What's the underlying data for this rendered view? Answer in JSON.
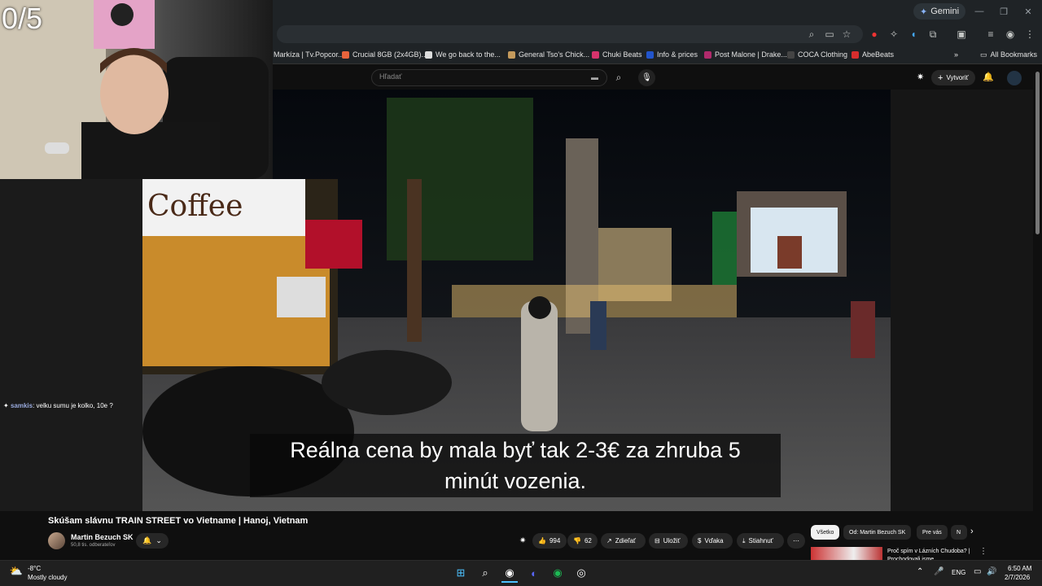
{
  "browser": {
    "gemini_label": "Gemini",
    "bookmarks": [
      {
        "label": "Markíza | Tv.Popcor...",
        "color": "#6b7a8f"
      },
      {
        "label": "Crucial 8GB (2x4GB)...",
        "color": "#e8643c"
      },
      {
        "label": "We go back to the...",
        "color": "#dddddd"
      },
      {
        "label": "General Tso's Chick...",
        "color": "#c49a5c"
      },
      {
        "label": "Chuki Beats",
        "color": "#d6336c"
      },
      {
        "label": "Info & prices",
        "color": "#2255cc"
      },
      {
        "label": "Post Malone | Drake...",
        "color": "#b02a6b"
      },
      {
        "label": "COCA Clothing",
        "color": "#222222"
      },
      {
        "label": "AbeBeats",
        "color": "#d62d2d"
      }
    ],
    "all_bookmarks": "All Bookmarks"
  },
  "youtube": {
    "search_placeholder": "Hľadať",
    "create_label": "Vytvoriť",
    "video_title": "Skúšam slávnu TRAIN STREET vo Vietname | Hanoj, Vietnam",
    "channel_name": "Martin Bezuch SK",
    "subscribers": "50,8 tis. odberateľov",
    "likes": "994",
    "dislikes": "62",
    "share": "Zdieľať",
    "save": "Uložiť",
    "thanks": "Vďaka",
    "download": "Stiahnuť",
    "subtitle_line1": "Reálna cena by mala byť tak 2-3€ za zhruba 5",
    "subtitle_line2": "minút vozenia.",
    "chips": [
      "Všetko",
      "Od: Martin Bezuch SK",
      "Pre vás",
      "N"
    ],
    "rec_title": "Proč spím v Lázních Chudoba? | Prochodovali jsme..."
  },
  "stream": {
    "counter": "0/5",
    "chat_user": "samkis",
    "chat_message": ": velku sumu je kolko, 10e ?"
  },
  "taskbar": {
    "temp": "-8°C",
    "weather": "Mostly cloudy",
    "lang": "ENG",
    "time": "6:50 AM",
    "date": "2/7/2026"
  },
  "colors": {
    "accent": "#ff0000",
    "chrome_bg": "#1f2326",
    "yt_bg": "#0f0f0f"
  }
}
